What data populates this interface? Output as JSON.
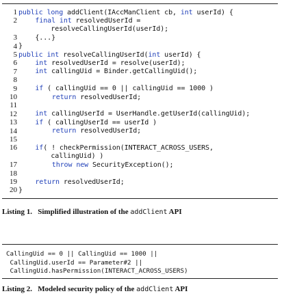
{
  "listing1": {
    "lines": [
      {
        "num": "1",
        "indent": 0,
        "segs": [
          {
            "t": "public long",
            "kw": true
          },
          {
            "t": " addClient(IAccManClient cb, "
          },
          {
            "t": "int",
            "kw": true
          },
          {
            "t": " userId) {"
          }
        ]
      },
      {
        "num": "2",
        "indent": 4,
        "segs": [
          {
            "t": "final int",
            "kw": true
          },
          {
            "t": " resolvedUserId ="
          }
        ]
      },
      {
        "num": "",
        "indent": 1,
        "segs": [
          {
            "t": "        resolveCallingUserId(userId);"
          }
        ]
      },
      {
        "num": "3",
        "indent": 4,
        "segs": [
          {
            "t": "{...}"
          }
        ]
      },
      {
        "num": "4",
        "indent": 0,
        "segs": [
          {
            "t": "}"
          }
        ]
      },
      {
        "num": "5",
        "indent": 0,
        "segs": [
          {
            "t": "public int",
            "kw": true
          },
          {
            "t": " resolveCallingUserId("
          },
          {
            "t": "int",
            "kw": true
          },
          {
            "t": " userId) {"
          }
        ]
      },
      {
        "num": "6",
        "indent": 4,
        "segs": [
          {
            "t": "int",
            "kw": true
          },
          {
            "t": " resolvedUserId = resolve(userId);"
          }
        ]
      },
      {
        "num": "7",
        "indent": 4,
        "segs": [
          {
            "t": "int",
            "kw": true
          },
          {
            "t": " callingUid = Binder.getCallingUid();"
          }
        ]
      },
      {
        "num": "8",
        "indent": 0,
        "segs": []
      },
      {
        "num": "9",
        "indent": 4,
        "segs": [
          {
            "t": "if",
            "kw": true
          },
          {
            "t": " ( callingUid == 0 || callingUid == 1000 )"
          }
        ]
      },
      {
        "num": "10",
        "indent": 8,
        "segs": [
          {
            "t": "return",
            "kw": true
          },
          {
            "t": " resolvedUserId;"
          }
        ]
      },
      {
        "num": "11",
        "indent": 0,
        "segs": []
      },
      {
        "num": "12",
        "indent": 4,
        "segs": [
          {
            "t": "int",
            "kw": true
          },
          {
            "t": " callingUserId = UserHandle.getUserId(callingUid);"
          }
        ]
      },
      {
        "num": "13",
        "indent": 4,
        "segs": [
          {
            "t": "if",
            "kw": true
          },
          {
            "t": " ( callingUserId == userId )"
          }
        ]
      },
      {
        "num": "14",
        "indent": 8,
        "segs": [
          {
            "t": "return",
            "kw": true
          },
          {
            "t": " resolvedUserId;"
          }
        ]
      },
      {
        "num": "15",
        "indent": 0,
        "segs": []
      },
      {
        "num": "16",
        "indent": 4,
        "segs": [
          {
            "t": "if",
            "kw": true
          },
          {
            "t": "( ! checkPermission(INTERACT_ACROSS_USERS,"
          }
        ]
      },
      {
        "num": "",
        "indent": 1,
        "segs": [
          {
            "t": "        callingUid) )"
          }
        ]
      },
      {
        "num": "17",
        "indent": 8,
        "segs": [
          {
            "t": "throw new",
            "kw": true
          },
          {
            "t": " SecurityException();"
          }
        ]
      },
      {
        "num": "18",
        "indent": 0,
        "segs": []
      },
      {
        "num": "19",
        "indent": 4,
        "segs": [
          {
            "t": "return",
            "kw": true
          },
          {
            "t": " resolvedUserId;"
          }
        ]
      },
      {
        "num": "20",
        "indent": 0,
        "segs": [
          {
            "t": "}"
          }
        ]
      }
    ]
  },
  "caption1": {
    "prefix": "Listing 1.   Simplified illustration of the ",
    "mono": "addClient",
    "suffix": " API"
  },
  "listing2": {
    "lines": [
      "CallingUid == 0 || CallingUid == 1000 ||",
      " CallingUid.userId == Parameter#2 ||",
      " CallingUid.hasPermission(INTERACT_ACROSS_USERS)"
    ]
  },
  "caption2": {
    "prefix": "Listing 2.   Modeled security policy of the ",
    "mono": "addClient",
    "suffix": " API"
  },
  "colors": {
    "keyword": "#1f3fb8",
    "text": "#111111"
  }
}
